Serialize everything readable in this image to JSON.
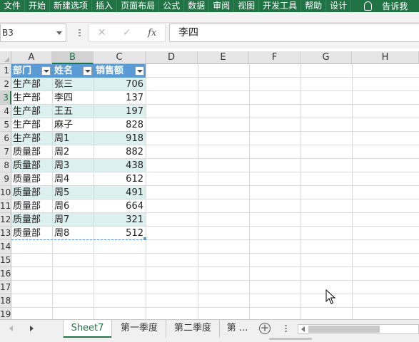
{
  "ribbon": {
    "tabs": [
      "文件",
      "开始",
      "新建选项",
      "插入",
      "页面布局",
      "公式",
      "数据",
      "审阅",
      "视图",
      "开发工具",
      "帮助",
      "设计"
    ],
    "tell_me": "告诉我",
    "color": "#217346"
  },
  "formula_bar": {
    "name_box": "B3",
    "cancel_icon": "✕",
    "enter_icon": "✓",
    "fx_label": "fx",
    "value": "李四"
  },
  "grid": {
    "columns": [
      "A",
      "B",
      "C",
      "D",
      "E",
      "F",
      "G",
      "H"
    ],
    "rows": [
      "1",
      "2",
      "3",
      "4",
      "5",
      "6",
      "7",
      "8",
      "9",
      "10",
      "11",
      "12",
      "13",
      "14",
      "15",
      "16",
      "17",
      "18",
      "19"
    ],
    "selected_column": "B",
    "selected_row": "3"
  },
  "table": {
    "headers": [
      "部门",
      "姓名",
      "销售额"
    ],
    "rows": [
      [
        "生产部",
        "张三",
        "706"
      ],
      [
        "生产部",
        "李四",
        "137"
      ],
      [
        "生产部",
        "王五",
        "197"
      ],
      [
        "生产部",
        "麻子",
        "828"
      ],
      [
        "生产部",
        "周1",
        "918"
      ],
      [
        "质量部",
        "周2",
        "882"
      ],
      [
        "质量部",
        "周3",
        "438"
      ],
      [
        "质量部",
        "周4",
        "612"
      ],
      [
        "质量部",
        "周5",
        "491"
      ],
      [
        "质量部",
        "周6",
        "664"
      ],
      [
        "质量部",
        "周7",
        "321"
      ],
      [
        "质量部",
        "周8",
        "512"
      ]
    ],
    "header_color": "#5b9bd5",
    "band_color": "#dcf0ef"
  },
  "sheets": {
    "tabs": [
      "Sheet7",
      "第一季度",
      "第二季度",
      "第 ..."
    ],
    "active": "Sheet7",
    "add_icon": "+"
  }
}
